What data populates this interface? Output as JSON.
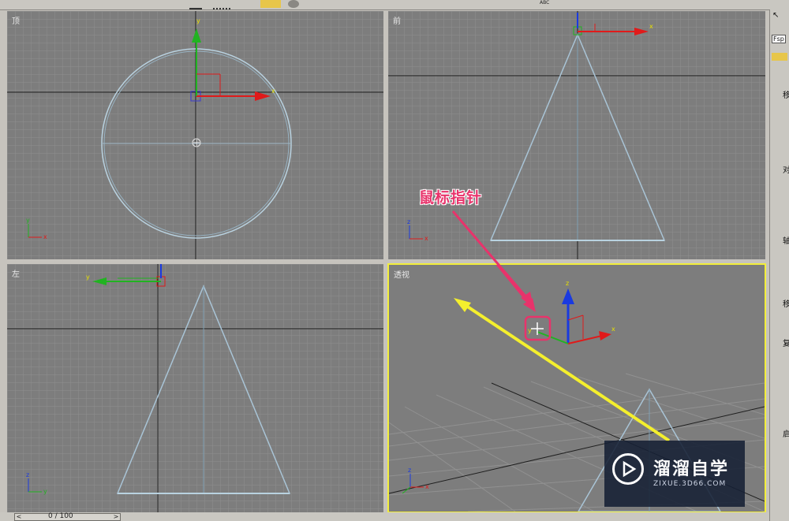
{
  "toolbar": {
    "icons": [
      "select-icon",
      "undo-icon",
      "selection-filter-icon",
      "move-tool-icon",
      "rotate-tool-icon",
      "abc-text-icon",
      "link-icon"
    ],
    "abc_label": "ABC"
  },
  "viewports": {
    "top": {
      "label": "顶"
    },
    "front": {
      "label": "前"
    },
    "left": {
      "label": "左"
    },
    "perspective": {
      "label": "透视"
    }
  },
  "axes": {
    "x": "x",
    "y": "y",
    "z": "z"
  },
  "callout": {
    "text": "鼠标指针"
  },
  "timeline": {
    "value": "0 / 100",
    "prev": "<",
    "next": ">"
  },
  "rightpanel": {
    "field_value": "Fsp",
    "chars": [
      "移",
      "对",
      "轴",
      "移",
      "复",
      "启"
    ]
  },
  "watermark": {
    "title": "溜溜自学",
    "subtitle": "ZIXUE.3D66.COM"
  },
  "colors": {
    "viewport_bg": "#7d7d7d",
    "grid": "#8f8f8f",
    "active_border": "#f2ee3b",
    "callout": "#e8336b",
    "cone": "#a9c4d6",
    "axis_x": "#e01a1a",
    "axis_y": "#21b321",
    "axis_z": "#1a3ae0"
  }
}
